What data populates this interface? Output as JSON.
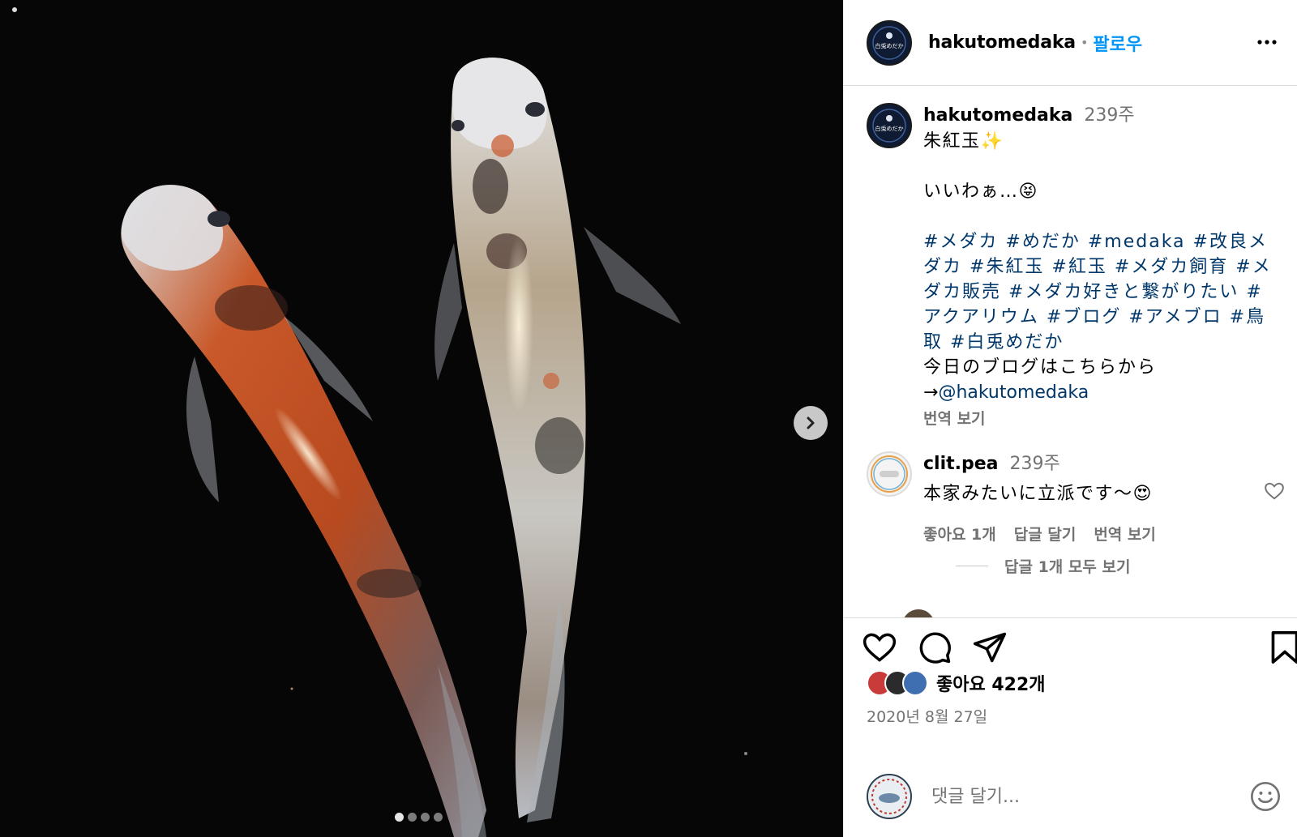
{
  "media": {
    "carousel": {
      "total": 4,
      "active_index": 0
    },
    "icons": {
      "next": "chevron-right-icon"
    }
  },
  "header": {
    "username": "hakutomedaka",
    "separator": "•",
    "follow_label": "팔로우",
    "avatar_text": "白兎めだか",
    "icons": {
      "more": "more-horizontal-icon"
    }
  },
  "caption": {
    "username": "hakutomedaka",
    "time": "239주",
    "text": "朱紅玉✨\n\nいいわぁ…😝",
    "hashtags": "#メダカ #めだか #medaka #改良メダカ #朱紅玉 #紅玉 #メダカ飼育 #メダカ販売 #メダカ好きと繋がりたい #アクアリウム #ブログ #アメブロ #鳥取 #白兎めだか",
    "blog_line": "今日のブログはこちらから",
    "arrow": "→",
    "mention": "@hakutomedaka",
    "translate_label": "번역 보기"
  },
  "comment": {
    "username": "clit.pea",
    "time": "239주",
    "text": "本家みたいに立派です～😍",
    "likes_label": "좋아요 1개",
    "reply_label": "답글 달기",
    "translate_label": "번역 보기",
    "view_replies_label": "답글 1개 모두 보기",
    "icons": {
      "like": "heart-outline-icon"
    }
  },
  "actions": {
    "icons": {
      "like": "heart-outline-icon",
      "comment": "comment-bubble-icon",
      "share": "paper-plane-icon",
      "save": "bookmark-icon"
    },
    "likes_label": "좋아요 422개",
    "date": "2020년 8월 27일"
  },
  "composer": {
    "placeholder": "댓글 달기...",
    "icons": {
      "emoji": "emoji-smile-icon"
    }
  },
  "colors": {
    "link": "#00376b",
    "follow": "#0095f6",
    "muted": "#737373"
  }
}
